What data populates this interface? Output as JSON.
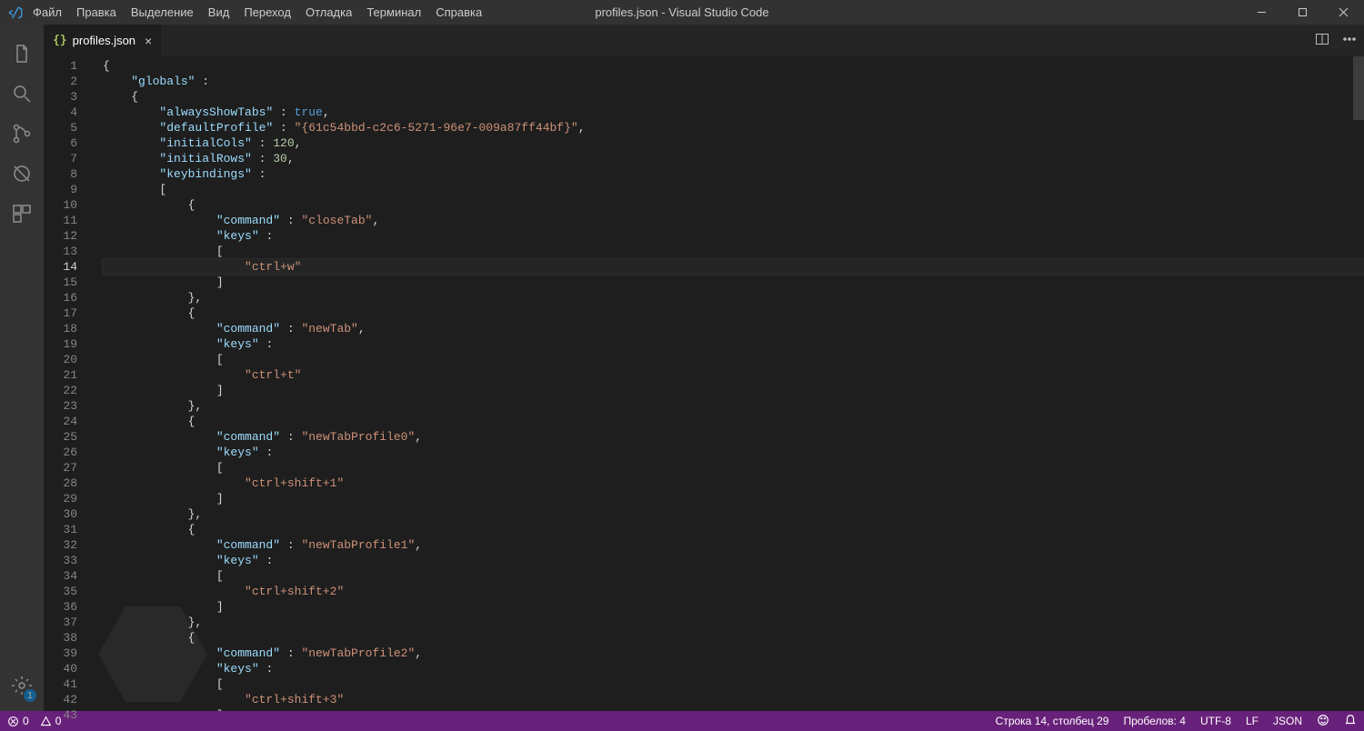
{
  "titlebar": {
    "menu": [
      "Файл",
      "Правка",
      "Выделение",
      "Вид",
      "Переход",
      "Отладка",
      "Терминал",
      "Справка"
    ],
    "title": "profiles.json - Visual Studio Code"
  },
  "activity": {
    "settings_badge": "1"
  },
  "tab": {
    "icon": "{}",
    "name": "profiles.json",
    "close": "×"
  },
  "editor": {
    "active_line": 14,
    "lines": [
      [
        {
          "t": "punc",
          "v": "{"
        }
      ],
      [
        {
          "t": "pad",
          "v": "    "
        },
        {
          "t": "key",
          "v": "\"globals\""
        },
        {
          "t": "punc",
          "v": " :"
        }
      ],
      [
        {
          "t": "pad",
          "v": "    "
        },
        {
          "t": "punc",
          "v": "{"
        }
      ],
      [
        {
          "t": "pad",
          "v": "        "
        },
        {
          "t": "key",
          "v": "\"alwaysShowTabs\""
        },
        {
          "t": "punc",
          "v": " : "
        },
        {
          "t": "bool",
          "v": "true"
        },
        {
          "t": "punc",
          "v": ","
        }
      ],
      [
        {
          "t": "pad",
          "v": "        "
        },
        {
          "t": "key",
          "v": "\"defaultProfile\""
        },
        {
          "t": "punc",
          "v": " : "
        },
        {
          "t": "str",
          "v": "\"{61c54bbd-c2c6-5271-96e7-009a87ff44bf}\""
        },
        {
          "t": "punc",
          "v": ","
        }
      ],
      [
        {
          "t": "pad",
          "v": "        "
        },
        {
          "t": "key",
          "v": "\"initialCols\""
        },
        {
          "t": "punc",
          "v": " : "
        },
        {
          "t": "num",
          "v": "120"
        },
        {
          "t": "punc",
          "v": ","
        }
      ],
      [
        {
          "t": "pad",
          "v": "        "
        },
        {
          "t": "key",
          "v": "\"initialRows\""
        },
        {
          "t": "punc",
          "v": " : "
        },
        {
          "t": "num",
          "v": "30"
        },
        {
          "t": "punc",
          "v": ","
        }
      ],
      [
        {
          "t": "pad",
          "v": "        "
        },
        {
          "t": "key",
          "v": "\"keybindings\""
        },
        {
          "t": "punc",
          "v": " :"
        }
      ],
      [
        {
          "t": "pad",
          "v": "        "
        },
        {
          "t": "punc",
          "v": "["
        }
      ],
      [
        {
          "t": "pad",
          "v": "            "
        },
        {
          "t": "punc",
          "v": "{"
        }
      ],
      [
        {
          "t": "pad",
          "v": "                "
        },
        {
          "t": "key",
          "v": "\"command\""
        },
        {
          "t": "punc",
          "v": " : "
        },
        {
          "t": "str",
          "v": "\"closeTab\""
        },
        {
          "t": "punc",
          "v": ","
        }
      ],
      [
        {
          "t": "pad",
          "v": "                "
        },
        {
          "t": "key",
          "v": "\"keys\""
        },
        {
          "t": "punc",
          "v": " :"
        }
      ],
      [
        {
          "t": "pad",
          "v": "                "
        },
        {
          "t": "punc",
          "v": "["
        }
      ],
      [
        {
          "t": "pad",
          "v": "                    "
        },
        {
          "t": "str",
          "v": "\"ctrl+w\""
        }
      ],
      [
        {
          "t": "pad",
          "v": "                "
        },
        {
          "t": "punc",
          "v": "]"
        }
      ],
      [
        {
          "t": "pad",
          "v": "            "
        },
        {
          "t": "punc",
          "v": "},"
        }
      ],
      [
        {
          "t": "pad",
          "v": "            "
        },
        {
          "t": "punc",
          "v": "{"
        }
      ],
      [
        {
          "t": "pad",
          "v": "                "
        },
        {
          "t": "key",
          "v": "\"command\""
        },
        {
          "t": "punc",
          "v": " : "
        },
        {
          "t": "str",
          "v": "\"newTab\""
        },
        {
          "t": "punc",
          "v": ","
        }
      ],
      [
        {
          "t": "pad",
          "v": "                "
        },
        {
          "t": "key",
          "v": "\"keys\""
        },
        {
          "t": "punc",
          "v": " :"
        }
      ],
      [
        {
          "t": "pad",
          "v": "                "
        },
        {
          "t": "punc",
          "v": "["
        }
      ],
      [
        {
          "t": "pad",
          "v": "                    "
        },
        {
          "t": "str",
          "v": "\"ctrl+t\""
        }
      ],
      [
        {
          "t": "pad",
          "v": "                "
        },
        {
          "t": "punc",
          "v": "]"
        }
      ],
      [
        {
          "t": "pad",
          "v": "            "
        },
        {
          "t": "punc",
          "v": "},"
        }
      ],
      [
        {
          "t": "pad",
          "v": "            "
        },
        {
          "t": "punc",
          "v": "{"
        }
      ],
      [
        {
          "t": "pad",
          "v": "                "
        },
        {
          "t": "key",
          "v": "\"command\""
        },
        {
          "t": "punc",
          "v": " : "
        },
        {
          "t": "str",
          "v": "\"newTabProfile0\""
        },
        {
          "t": "punc",
          "v": ","
        }
      ],
      [
        {
          "t": "pad",
          "v": "                "
        },
        {
          "t": "key",
          "v": "\"keys\""
        },
        {
          "t": "punc",
          "v": " :"
        }
      ],
      [
        {
          "t": "pad",
          "v": "                "
        },
        {
          "t": "punc",
          "v": "["
        }
      ],
      [
        {
          "t": "pad",
          "v": "                    "
        },
        {
          "t": "str",
          "v": "\"ctrl+shift+1\""
        }
      ],
      [
        {
          "t": "pad",
          "v": "                "
        },
        {
          "t": "punc",
          "v": "]"
        }
      ],
      [
        {
          "t": "pad",
          "v": "            "
        },
        {
          "t": "punc",
          "v": "},"
        }
      ],
      [
        {
          "t": "pad",
          "v": "            "
        },
        {
          "t": "punc",
          "v": "{"
        }
      ],
      [
        {
          "t": "pad",
          "v": "                "
        },
        {
          "t": "key",
          "v": "\"command\""
        },
        {
          "t": "punc",
          "v": " : "
        },
        {
          "t": "str",
          "v": "\"newTabProfile1\""
        },
        {
          "t": "punc",
          "v": ","
        }
      ],
      [
        {
          "t": "pad",
          "v": "                "
        },
        {
          "t": "key",
          "v": "\"keys\""
        },
        {
          "t": "punc",
          "v": " :"
        }
      ],
      [
        {
          "t": "pad",
          "v": "                "
        },
        {
          "t": "punc",
          "v": "["
        }
      ],
      [
        {
          "t": "pad",
          "v": "                    "
        },
        {
          "t": "str",
          "v": "\"ctrl+shift+2\""
        }
      ],
      [
        {
          "t": "pad",
          "v": "                "
        },
        {
          "t": "punc",
          "v": "]"
        }
      ],
      [
        {
          "t": "pad",
          "v": "            "
        },
        {
          "t": "punc",
          "v": "},"
        }
      ],
      [
        {
          "t": "pad",
          "v": "            "
        },
        {
          "t": "punc",
          "v": "{"
        }
      ],
      [
        {
          "t": "pad",
          "v": "                "
        },
        {
          "t": "key",
          "v": "\"command\""
        },
        {
          "t": "punc",
          "v": " : "
        },
        {
          "t": "str",
          "v": "\"newTabProfile2\""
        },
        {
          "t": "punc",
          "v": ","
        }
      ],
      [
        {
          "t": "pad",
          "v": "                "
        },
        {
          "t": "key",
          "v": "\"keys\""
        },
        {
          "t": "punc",
          "v": " :"
        }
      ],
      [
        {
          "t": "pad",
          "v": "                "
        },
        {
          "t": "punc",
          "v": "["
        }
      ],
      [
        {
          "t": "pad",
          "v": "                    "
        },
        {
          "t": "str",
          "v": "\"ctrl+shift+3\""
        }
      ],
      [
        {
          "t": "pad",
          "v": "                "
        },
        {
          "t": "punc",
          "v": "]"
        }
      ]
    ]
  },
  "status": {
    "errors": "0",
    "warnings": "0",
    "cursor": "Строка 14, столбец 29",
    "spaces": "Пробелов: 4",
    "encoding": "UTF-8",
    "eol": "LF",
    "lang": "JSON"
  }
}
